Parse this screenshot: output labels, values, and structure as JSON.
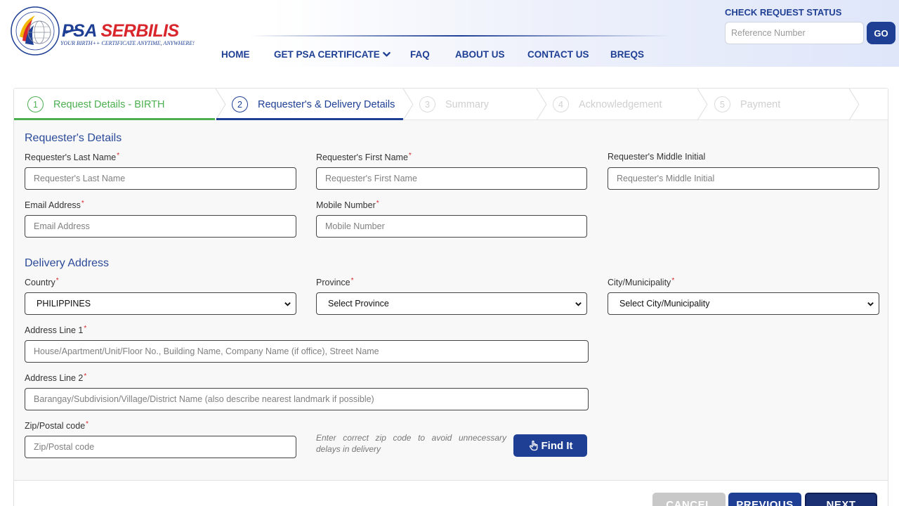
{
  "brand": {
    "name_part1": "PSA",
    "name_part2": "SERBILIS",
    "tagline": "YOUR BIRTH++ CERTIFICATE ANYTIME, ANYWHERE!",
    "colors": {
      "primary": "#1e3f94",
      "accent": "#d8262c",
      "success": "#4caf50"
    }
  },
  "nav": {
    "items": [
      {
        "label": "HOME"
      },
      {
        "label": "GET PSA CERTIFICATE",
        "icon": "chevron-down-icon"
      },
      {
        "label": "FAQ"
      },
      {
        "label": "ABOUT US"
      },
      {
        "label": "CONTACT US"
      },
      {
        "label": "BREQS"
      }
    ]
  },
  "status_check": {
    "title": "CHECK REQUEST STATUS",
    "placeholder": "Reference Number",
    "value": "",
    "button": "GO"
  },
  "steps": [
    {
      "num": "1",
      "label": "Request Details - BIRTH",
      "state": "done"
    },
    {
      "num": "2",
      "label": "Requester's & Delivery Details",
      "state": "active"
    },
    {
      "num": "3",
      "label": "Summary",
      "state": "todo"
    },
    {
      "num": "4",
      "label": "Acknowledgement",
      "state": "todo"
    },
    {
      "num": "5",
      "label": "Payment",
      "state": "todo"
    }
  ],
  "requester": {
    "title": "Requester's Details",
    "last_name": {
      "label": "Requester's Last Name",
      "placeholder": "Requester's Last Name",
      "value": ""
    },
    "first_name": {
      "label": "Requester's First Name",
      "placeholder": "Requester's First Name",
      "value": ""
    },
    "middle_initial": {
      "label": "Requester's Middle Initial",
      "placeholder": "Requester's Middle Initial",
      "value": ""
    },
    "email": {
      "label": "Email Address",
      "placeholder": "Email Address",
      "value": ""
    },
    "mobile": {
      "label": "Mobile Number",
      "placeholder": "Mobile Number",
      "value": ""
    }
  },
  "delivery": {
    "title": "Delivery Address",
    "country": {
      "label": "Country",
      "value": "PHILIPPINES"
    },
    "province": {
      "label": "Province",
      "value": "Select Province"
    },
    "city": {
      "label": "City/Municipality",
      "value": "Select City/Municipality"
    },
    "address1": {
      "label": "Address Line 1",
      "placeholder": "House/Apartment/Unit/Floor No., Building Name, Company Name (if office), Street Name",
      "value": ""
    },
    "address2": {
      "label": "Address Line 2",
      "placeholder": "Barangay/Subdivision/Village/District Name (also describe nearest landmark if possible)",
      "value": ""
    },
    "zip": {
      "label": "Zip/Postal code",
      "placeholder": "Zip/Postal code",
      "value": ""
    },
    "zip_hint": "Enter correct zip code to avoid unnecessary delays in delivery",
    "find_button": "Find It"
  },
  "actions": {
    "cancel": "CANCEL",
    "previous": "PREVIOUS",
    "next": "NEXT",
    "colors": {
      "cancel": "#c8c8c8",
      "previous": "#1e3f94",
      "next": "#1b2f73"
    }
  }
}
